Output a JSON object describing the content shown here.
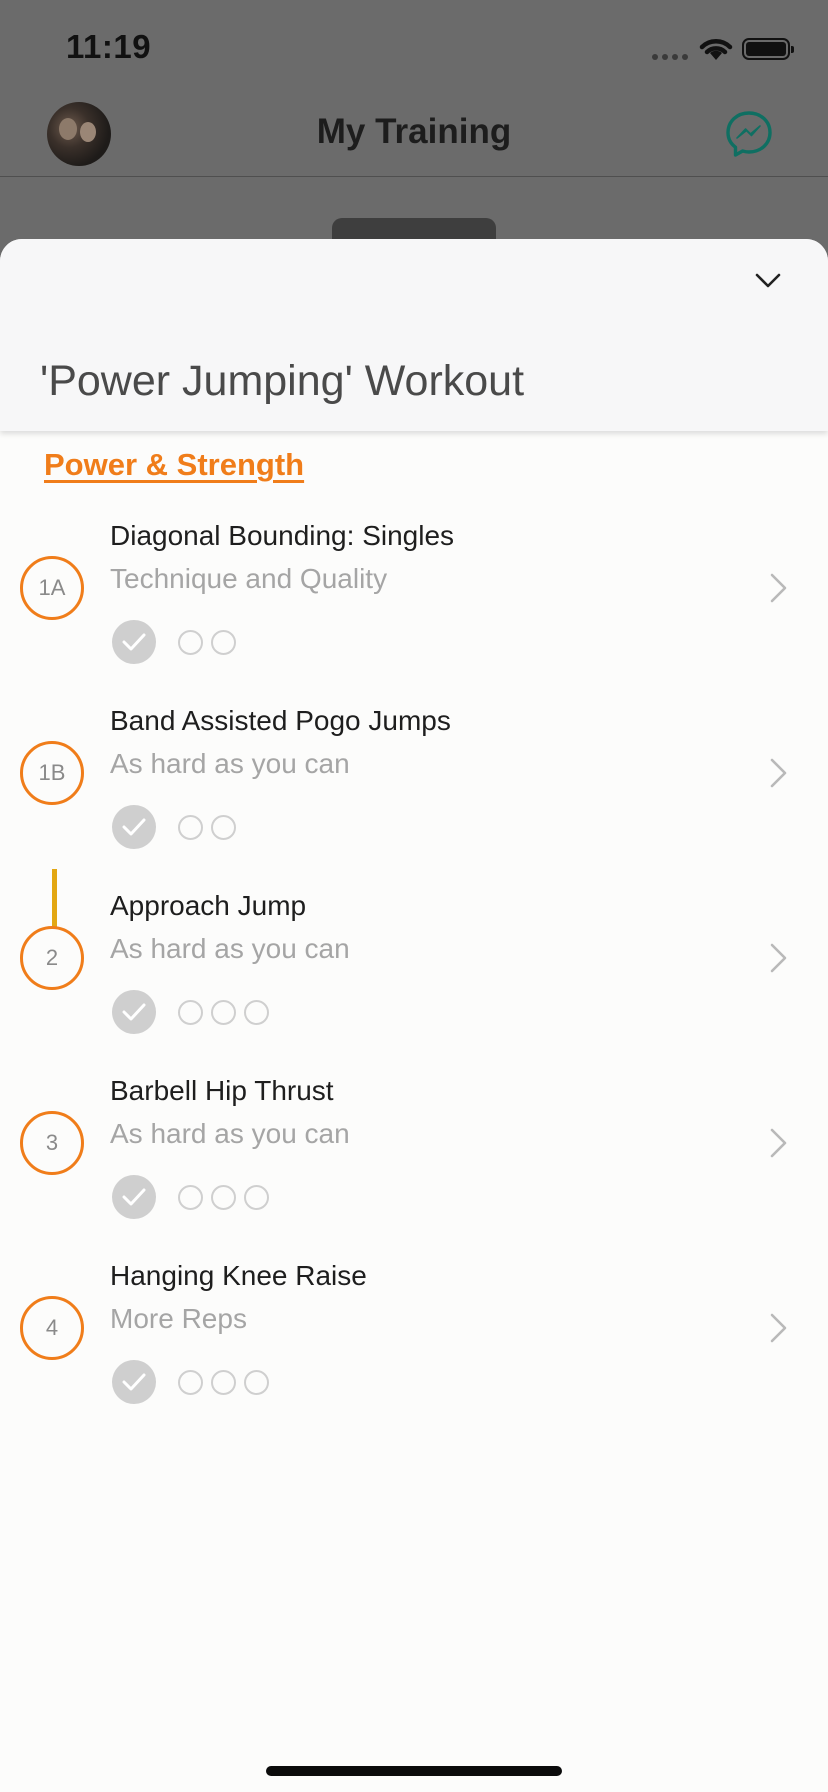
{
  "status_bar": {
    "time": "11:19"
  },
  "nav": {
    "title": "My Training"
  },
  "sheet": {
    "title": "'Power Jumping' Workout",
    "section": "Power & Strength"
  },
  "exercises": [
    {
      "badge": "1A",
      "name": "Diagonal Bounding: Singles",
      "intensity": "Technique and Quality",
      "sets_done": 1,
      "sets_open": 2
    },
    {
      "badge": "1B",
      "name": "Band Assisted Pogo Jumps",
      "intensity": "As hard as you can",
      "sets_done": 1,
      "sets_open": 2
    },
    {
      "badge": "2",
      "name": "Approach Jump",
      "intensity": "As hard as you can",
      "sets_done": 1,
      "sets_open": 3
    },
    {
      "badge": "3",
      "name": "Barbell Hip Thrust",
      "intensity": "As hard as you can",
      "sets_done": 1,
      "sets_open": 3
    },
    {
      "badge": "4",
      "name": "Hanging Knee Raise",
      "intensity": "More Reps",
      "sets_done": 1,
      "sets_open": 3
    }
  ],
  "colors": {
    "accent": "#f07d1a",
    "superset_connector": "#e3a712",
    "messenger": "#0f6f62",
    "completed_set": "#cfcfcf"
  },
  "icons": {
    "collapse": "chevron-down-icon",
    "row": "chevron-right-icon",
    "chat": "messenger-icon",
    "set_done": "check-icon"
  }
}
